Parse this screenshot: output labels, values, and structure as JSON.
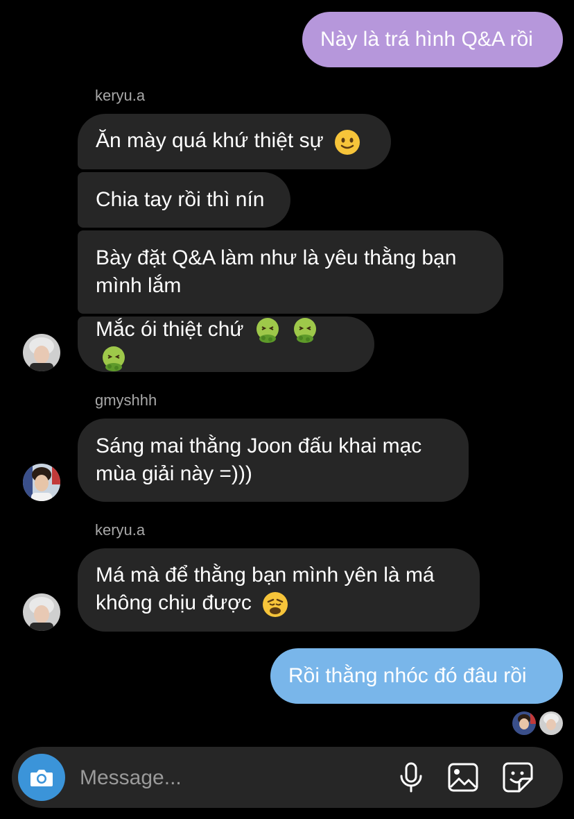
{
  "messages": {
    "m1": {
      "text": "Này là trá hình Q&A rồi"
    },
    "g1_sender": "keryu.a",
    "m2": {
      "text": "Ăn mày quá khứ thiệt sự"
    },
    "m3": {
      "text": "Chia tay rồi thì nín"
    },
    "m4": {
      "line1": "Bày đặt Q&A làm như là yêu thằng bạn",
      "line2": "mình lắm"
    },
    "m5": {
      "text": "Mắc ói thiệt chứ"
    },
    "g2_sender": "gmyshhh",
    "m6": {
      "line1": "Sáng mai thằng Joon đấu khai mạc",
      "line2": "mùa giải này =)))"
    },
    "g3_sender": "keryu.a",
    "m7": {
      "line1": "Má mà để thằng bạn mình yên là má",
      "line2": "không chịu được"
    },
    "m8": {
      "text": "Rồi thằng nhóc đó đâu rồi"
    }
  },
  "emoji": {
    "m2": "slightly-smiling-face",
    "m5": [
      "nauseated-face",
      "nauseated-face",
      "nauseated-face"
    ],
    "m7": "weary-face"
  },
  "composer": {
    "placeholder": "Message..."
  },
  "colors": {
    "outgoing_purple": "#b697db",
    "outgoing_blue": "#79b6ea",
    "incoming": "#262626",
    "camera": "#3b94d9"
  }
}
